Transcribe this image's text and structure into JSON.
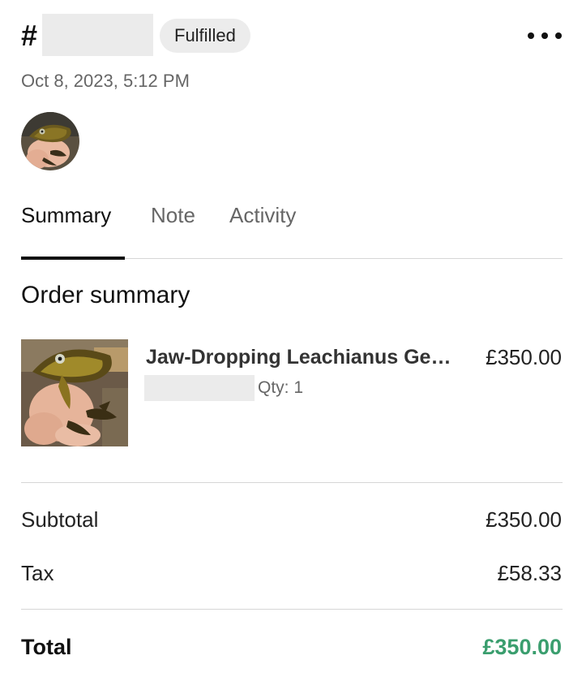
{
  "header": {
    "hash": "#",
    "status_badge": "Fulfilled",
    "date": "Oct 8, 2023, 5:12 PM",
    "more_icon": "more-horizontal-icon"
  },
  "tabs": [
    {
      "label": "Summary",
      "active": true
    },
    {
      "label": "Note",
      "active": false
    },
    {
      "label": "Activity",
      "active": false
    }
  ],
  "order_summary": {
    "title": "Order summary",
    "item": {
      "name": "Jaw-Dropping Leachianus Gecko",
      "price": "£350.00",
      "qty": "Qty: 1"
    },
    "subtotal_label": "Subtotal",
    "subtotal_value": "£350.00",
    "tax_label": "Tax",
    "tax_value": "£58.33",
    "total_label": "Total",
    "total_value": "£350.00"
  },
  "colors": {
    "total_accent": "#3a9e6e",
    "badge_bg": "#ececec"
  }
}
